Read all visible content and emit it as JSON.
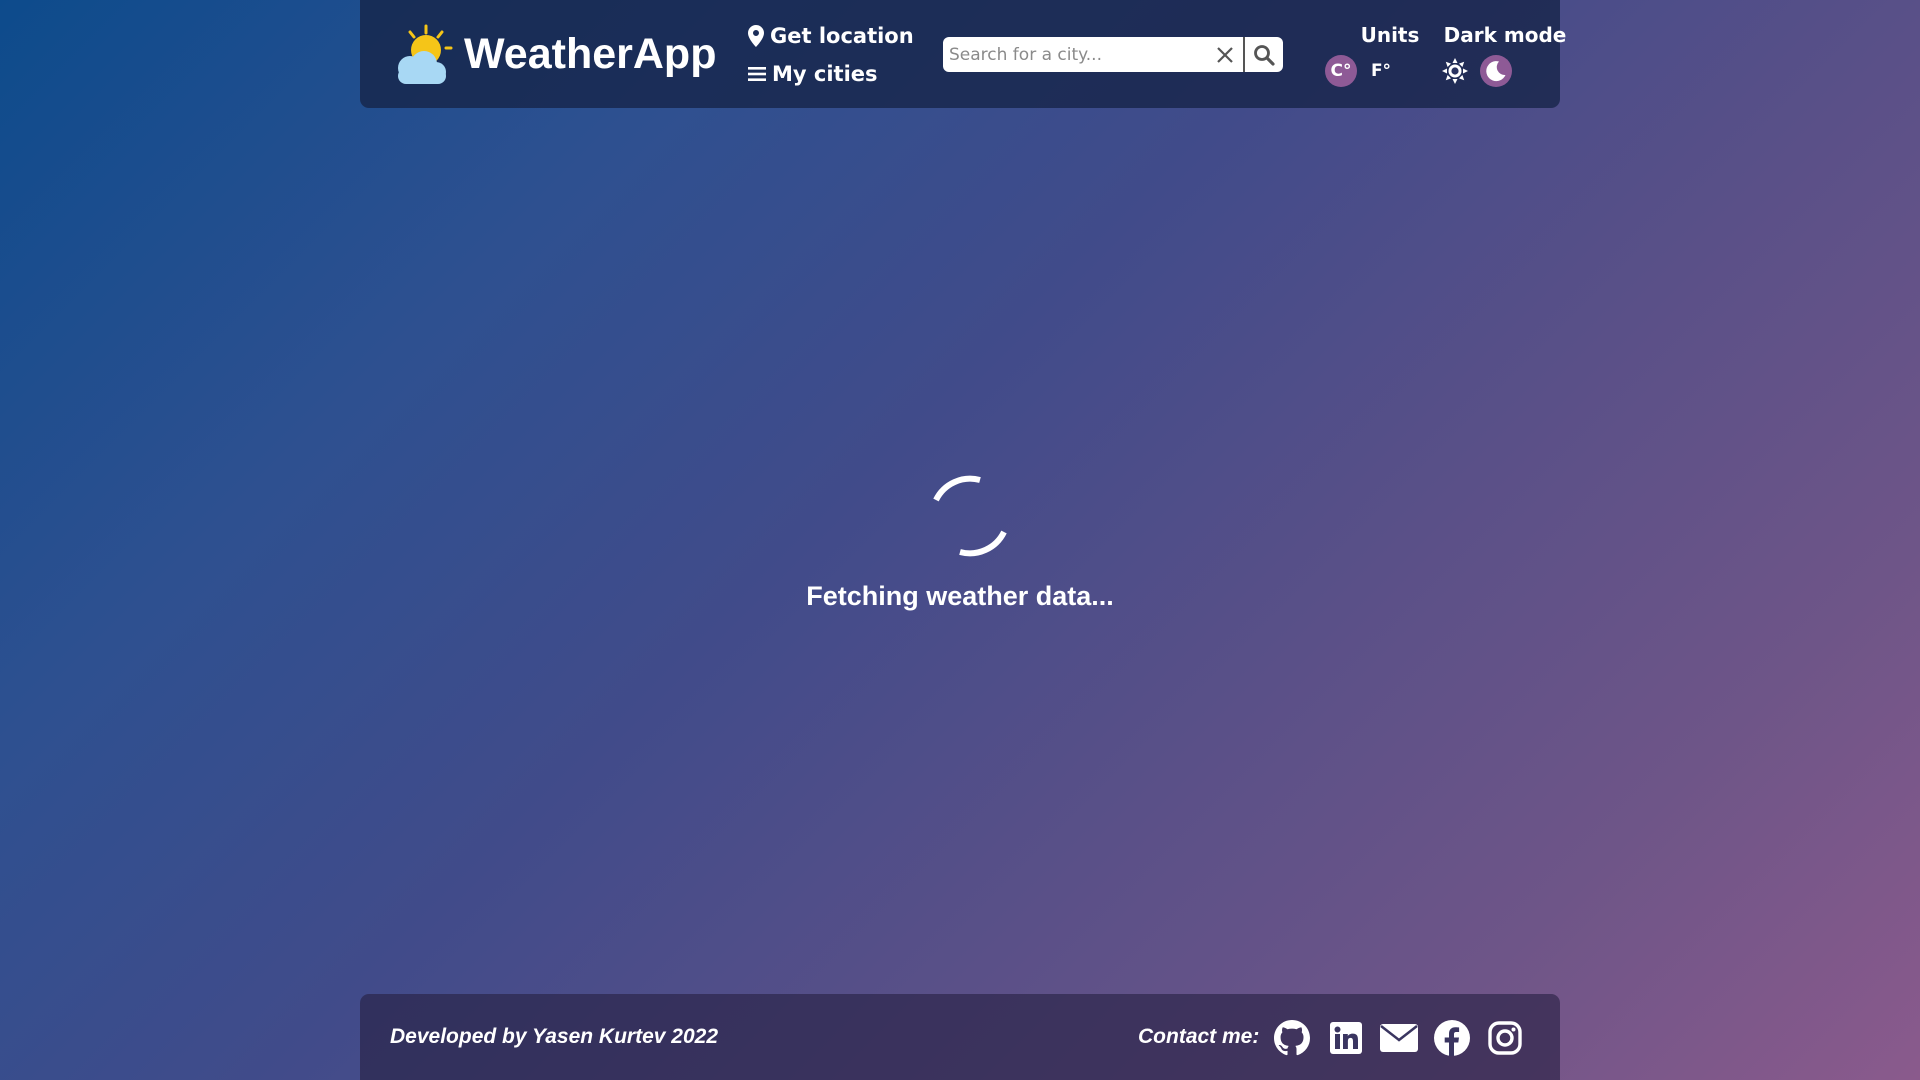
{
  "header": {
    "app_title": "WeatherApp",
    "nav": {
      "get_location": "Get location",
      "my_cities": "My cities"
    },
    "search": {
      "placeholder": "Search for a city...",
      "value": ""
    },
    "units": {
      "label": "Units",
      "celsius": "C°",
      "fahrenheit": "F°",
      "selected": "celsius"
    },
    "dark_mode": {
      "label": "Dark mode",
      "selected": "dark"
    }
  },
  "main": {
    "loading_text": "Fetching weather data..."
  },
  "footer": {
    "credit": "Developed by Yasen Kurtev 2022",
    "contact_label": "Contact me:",
    "social_icons": [
      "github-icon",
      "linkedin-icon",
      "email-icon",
      "facebook-icon",
      "instagram-icon"
    ]
  },
  "colors": {
    "accent": "#8e5a96",
    "header_bg": "#162448",
    "sun": "#f5c518",
    "cloud": "#a8d8f4"
  }
}
